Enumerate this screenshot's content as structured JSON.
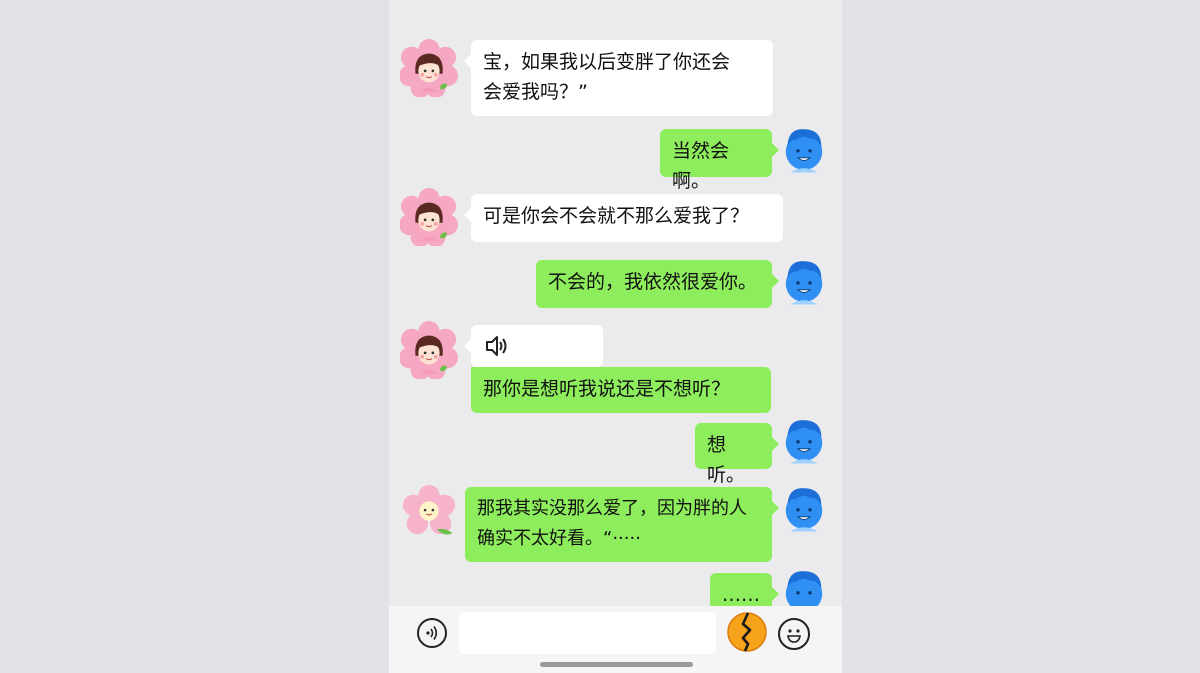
{
  "messages": [
    {
      "side": "left",
      "avatar": "girl-avatar",
      "text_lines": [
        "宝，如果我以后变胖了你还会",
        "会爱我吗？”"
      ]
    },
    {
      "side": "right",
      "avatar": "boy-avatar",
      "text": "当然会啊。"
    },
    {
      "side": "left",
      "avatar": "girl-avatar",
      "text": "可是你会不会就不那么爱我了？"
    },
    {
      "side": "right",
      "avatar": "boy-avatar",
      "text": "不会的，我依然很爱你。"
    },
    {
      "side": "left",
      "avatar": "girl-avatar",
      "voice_icon": "speaker-icon",
      "text": "那你是想听我说还是不想听？"
    },
    {
      "side": "right",
      "avatar": "boy-avatar",
      "text": "想听。"
    },
    {
      "side": "right",
      "avatar": "flower-avatar",
      "text_lines": [
        "那我其实没那么爱了，因为胖的人",
        "确实不太好看。“·····"
      ]
    },
    {
      "side": "right",
      "avatar": "boy-avatar",
      "text": "……"
    }
  ],
  "input_bar": {
    "voice_icon": "voice-input-icon",
    "input_value": "",
    "broken_heart_icon": "cracked-emoji-icon",
    "emoji_icon": "smiley-icon"
  },
  "colors": {
    "sent_bubble": "#8ded5c",
    "received_bubble": "#ffffff",
    "chat_background": "#ebebee",
    "boy_avatar": "#2f8ff2",
    "girl_avatar_petals": "#f7a9c4"
  }
}
